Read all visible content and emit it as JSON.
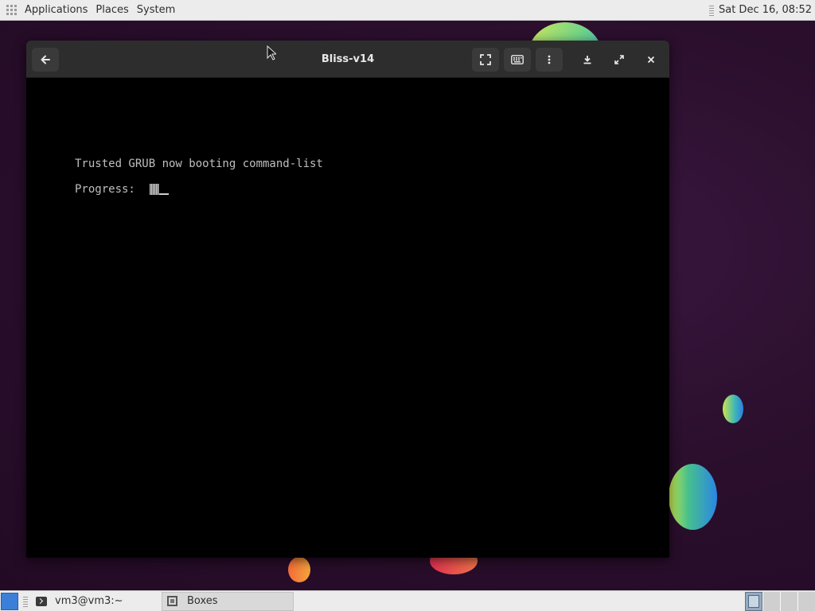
{
  "top_panel": {
    "menus": [
      "Applications",
      "Places",
      "System"
    ],
    "clock": "Sat Dec 16, 08:52"
  },
  "window": {
    "title": "Bliss-v14",
    "buttons": {
      "back": "back-arrow-icon",
      "fullscreen": "fullscreen-icon",
      "keyboard": "keyboard-icon",
      "menu": "vertical-dots-icon",
      "minimize": "minimize-icon",
      "maximize": "maximize-icon",
      "close": "close-icon"
    }
  },
  "console": {
    "line1": "Trusted GRUB now booting command-list",
    "progress_label": "Progress:"
  },
  "taskbar": {
    "tasks": [
      {
        "label": "vm3@vm3:~",
        "icon": "terminal-icon"
      },
      {
        "label": "Boxes",
        "icon": "boxes-icon"
      }
    ],
    "workspaces": 4,
    "active_workspace": 1
  },
  "colors": {
    "panel": "#ececec",
    "header_bar": "#2d2d2d",
    "console_bg": "#000000",
    "console_text": "#bfbfbf",
    "desktop": "#2a0f2c"
  }
}
